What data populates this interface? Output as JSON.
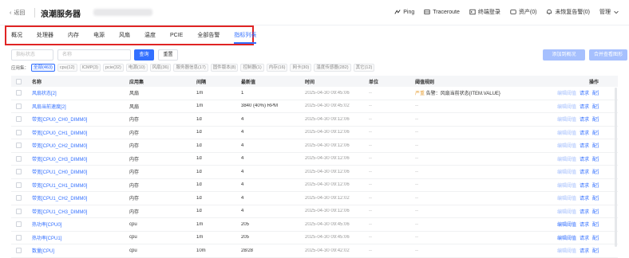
{
  "header": {
    "back_label": "返回",
    "title": "浪潮服务器",
    "actions": [
      {
        "label": "Ping",
        "icon": "ping-icon"
      },
      {
        "label": "Traceroute",
        "icon": "traceroute-icon"
      },
      {
        "label": "终端登录",
        "icon": "terminal-icon"
      },
      {
        "label": "资产(0)",
        "icon": "asset-icon"
      },
      {
        "label": "未恢复告警(0)",
        "icon": "bell-icon"
      },
      {
        "label": "管理",
        "icon": "chevron-down-icon"
      }
    ]
  },
  "tabs": [
    "概况",
    "处理器",
    "内存",
    "电源",
    "风扇",
    "温度",
    "PCIE",
    "全部告警",
    "指标列表"
  ],
  "active_tab": "指标列表",
  "filters": {
    "status_placeholder": "指标状态",
    "name_placeholder": "名称",
    "query_label": "查询",
    "reset_label": "重置",
    "add_overview_label": "添加到概况",
    "select_view_label": "合并查看图形"
  },
  "categories": {
    "label": "应用集：",
    "items": [
      "全部(463)",
      "cpu(12)",
      "ICMP(3)",
      "pcie(32)",
      "电源(10)",
      "风扇(36)",
      "服务器信息(17)",
      "固件版本(8)",
      "控制器(1)",
      "内存(16)",
      "网卡(30)",
      "温度传感器(282)",
      "其它(12)"
    ]
  },
  "table": {
    "columns": [
      "名称",
      "应用集",
      "间隔",
      "最新值",
      "时间",
      "单位",
      "阈值规则",
      "操作"
    ],
    "rows": [
      {
        "name": "风扇状态[2]",
        "app": "风扇",
        "interval": "1m",
        "value": "1",
        "time": "2025-04-30 09:45:06",
        "unit": "--",
        "rule": "严重 告警：风扇当前状态{ITEM.VALUE}",
        "ops": [
          "编辑阈值",
          "请求",
          "配置"
        ],
        "rule_warn": true
      },
      {
        "name": "风扇当前速度[2]",
        "app": "风扇",
        "interval": "1m",
        "value": "3840 (40%) RPM",
        "time": "2025-04-30 09:45:02",
        "unit": "--",
        "rule": "--",
        "ops": [
          "编辑阈值",
          "请求",
          "配置"
        ]
      },
      {
        "name": "带宽[CPU0_CH0_DIMM0]",
        "app": "内存",
        "interval": "1d",
        "value": "4",
        "time": "2025-04-30 09:12:06",
        "unit": "--",
        "rule": "--",
        "ops": [
          "编辑阈值",
          "请求",
          "配置"
        ]
      },
      {
        "name": "带宽[CPU0_CH1_DIMM0]",
        "app": "内存",
        "interval": "1d",
        "value": "4",
        "time": "2025-04-30 09:12:06",
        "unit": "--",
        "rule": "--",
        "ops": [
          "编辑阈值",
          "请求",
          "配置"
        ]
      },
      {
        "name": "带宽[CPU0_CH2_DIMM0]",
        "app": "内存",
        "interval": "1d",
        "value": "4",
        "time": "2025-04-30 09:12:06",
        "unit": "--",
        "rule": "--",
        "ops": [
          "编辑阈值",
          "请求",
          "配置"
        ]
      },
      {
        "name": "带宽[CPU0_CH3_DIMM0]",
        "app": "内存",
        "interval": "1d",
        "value": "4",
        "time": "2025-04-30 09:12:06",
        "unit": "--",
        "rule": "--",
        "ops": [
          "编辑阈值",
          "请求",
          "配置"
        ]
      },
      {
        "name": "带宽[CPU1_CH0_DIMM0]",
        "app": "内存",
        "interval": "1d",
        "value": "4",
        "time": "2025-04-30 09:12:06",
        "unit": "--",
        "rule": "--",
        "ops": [
          "编辑阈值",
          "请求",
          "配置"
        ]
      },
      {
        "name": "带宽[CPU1_CH1_DIMM0]",
        "app": "内存",
        "interval": "1d",
        "value": "4",
        "time": "2025-04-30 09:12:06",
        "unit": "--",
        "rule": "--",
        "ops": [
          "编辑阈值",
          "请求",
          "配置"
        ]
      },
      {
        "name": "带宽[CPU1_CH2_DIMM0]",
        "app": "内存",
        "interval": "1d",
        "value": "4",
        "time": "2025-04-30 09:12:02",
        "unit": "--",
        "rule": "--",
        "ops": [
          "编辑阈值",
          "请求",
          "配置"
        ]
      },
      {
        "name": "带宽[CPU1_CH3_DIMM0]",
        "app": "内存",
        "interval": "1d",
        "value": "4",
        "time": "2025-04-30 09:12:06",
        "unit": "--",
        "rule": "--",
        "ops": [
          "编辑阈值",
          "请求",
          "配置"
        ]
      },
      {
        "name": "热功率[CPU0]",
        "app": "cpu",
        "interval": "1m",
        "value": "205",
        "time": "2025-04-30 09:45:06",
        "unit": "--",
        "rule": "--",
        "ops": [
          "编辑阈值",
          "请求",
          "配置"
        ],
        "ops_active": true
      },
      {
        "name": "热功率[CPU1]",
        "app": "cpu",
        "interval": "1m",
        "value": "205",
        "time": "2025-04-30 09:45:06",
        "unit": "--",
        "rule": "--",
        "ops": [
          "编辑阈值",
          "请求",
          "配置"
        ],
        "ops_active": true
      },
      {
        "name": "数量[CPU]",
        "app": "cpu",
        "interval": "10m",
        "value": "28/28",
        "time": "2025-04-30 09:42:02",
        "unit": "--",
        "rule": "--",
        "ops": [
          "编辑阈值",
          "请求",
          "配置"
        ]
      }
    ]
  }
}
